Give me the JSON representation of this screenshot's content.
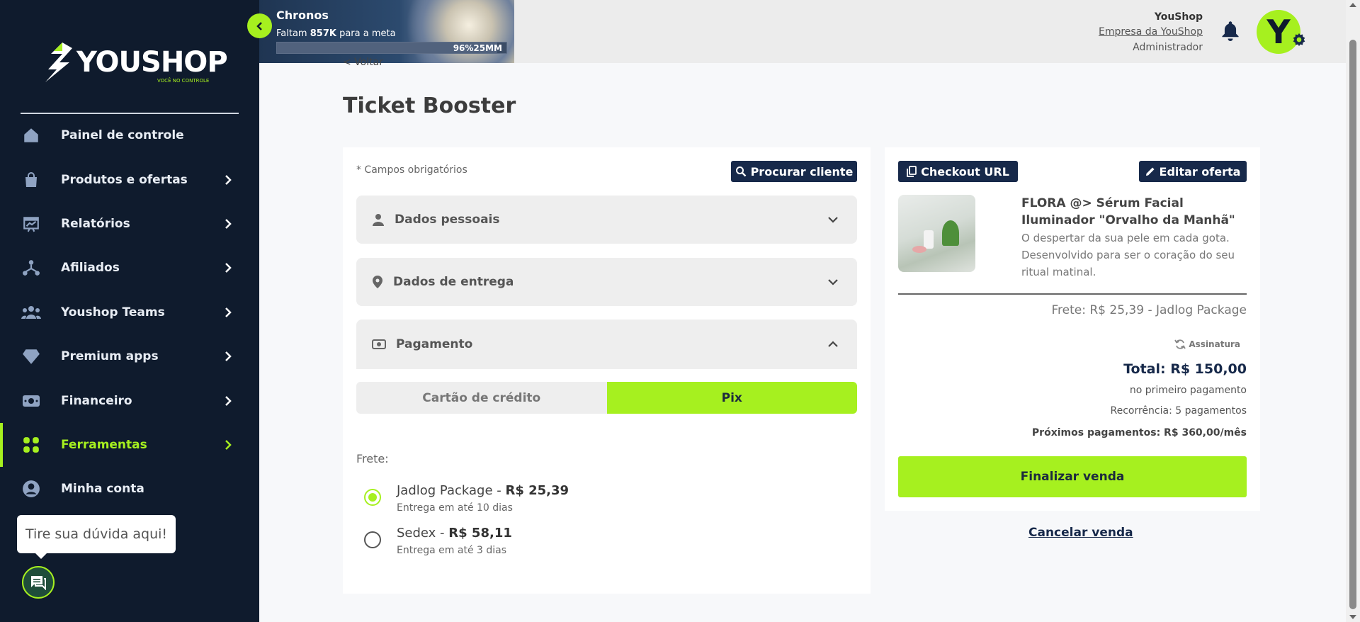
{
  "brand": {
    "name": "YOUSHOP",
    "tagline": "VOCÊ NO CONTROLE",
    "accent": "#a6f01f",
    "navy": "#17294a",
    "sidebar_bg": "#0f1b2d"
  },
  "sidebar": {
    "items": [
      {
        "label": "Painel de controle",
        "icon": "home-icon",
        "has_chevron": false
      },
      {
        "label": "Produtos e ofertas",
        "icon": "shopping-bag-icon",
        "has_chevron": true
      },
      {
        "label": "Relatórios",
        "icon": "report-chart-icon",
        "has_chevron": true
      },
      {
        "label": "Afiliados",
        "icon": "affiliates-network-icon",
        "has_chevron": true
      },
      {
        "label": "Youshop Teams",
        "icon": "team-icon",
        "has_chevron": true
      },
      {
        "label": "Premium apps",
        "icon": "diamond-icon",
        "has_chevron": true
      },
      {
        "label": "Financeiro",
        "icon": "money-icon",
        "has_chevron": true
      },
      {
        "label": "Ferramentas",
        "icon": "apps-grid-icon",
        "has_chevron": true,
        "active": true
      },
      {
        "label": "Minha conta",
        "icon": "account-circle-icon",
        "has_chevron": false
      }
    ],
    "help_text": "Tire sua dúvida aqui!"
  },
  "banner": {
    "title": "Chronos",
    "sub_prefix": "Faltam",
    "sub_amount": "857K",
    "sub_suffix": "para a meta",
    "progress_text": "96%25MM",
    "progress": 0.96
  },
  "user": {
    "name": "YouShop",
    "company": "Empresa da YouShop",
    "role": "Administrador",
    "avatar_letter": "Y"
  },
  "page": {
    "back": "< Voltar",
    "title": "Ticket Booster"
  },
  "form": {
    "required_note": "* Campos obrigatórios",
    "search_client": "Procurar cliente",
    "sections": {
      "personal": "Dados pessoais",
      "delivery": "Dados de entrega",
      "payment": "Pagamento"
    },
    "payment_tabs": {
      "credit": "Cartão de crédito",
      "pix": "Pix"
    },
    "frete_label": "Frete:",
    "shipping": [
      {
        "name": "Jadlog Package - ",
        "price": "R$ 25,39",
        "eta": "Entrega em até 10 dias",
        "selected": true
      },
      {
        "name": "Sedex - ",
        "price": "R$ 58,11",
        "eta": "Entrega em até 3 dias",
        "selected": false
      }
    ]
  },
  "summary": {
    "checkout_url": "Checkout URL",
    "edit_offer": "Editar oferta",
    "product_title": "FLORA @> Sérum Facial Iluminador \"Orvalho da Manhã\"",
    "product_desc": "O despertar da sua pele em cada gota. Desenvolvido para ser o coração do seu ritual matinal.",
    "frete": "Frete: R$ 25,39 - Jadlog Package",
    "subscription": "Assinatura",
    "total": "Total: R$ 150,00",
    "first_payment": "no primeiro pagamento",
    "recurrence": "Recorrência: 5 pagamentos",
    "next_payments": "Próximos pagamentos: R$ 360,00/mês",
    "finalize": "Finalizar venda",
    "cancel": "Cancelar venda"
  }
}
